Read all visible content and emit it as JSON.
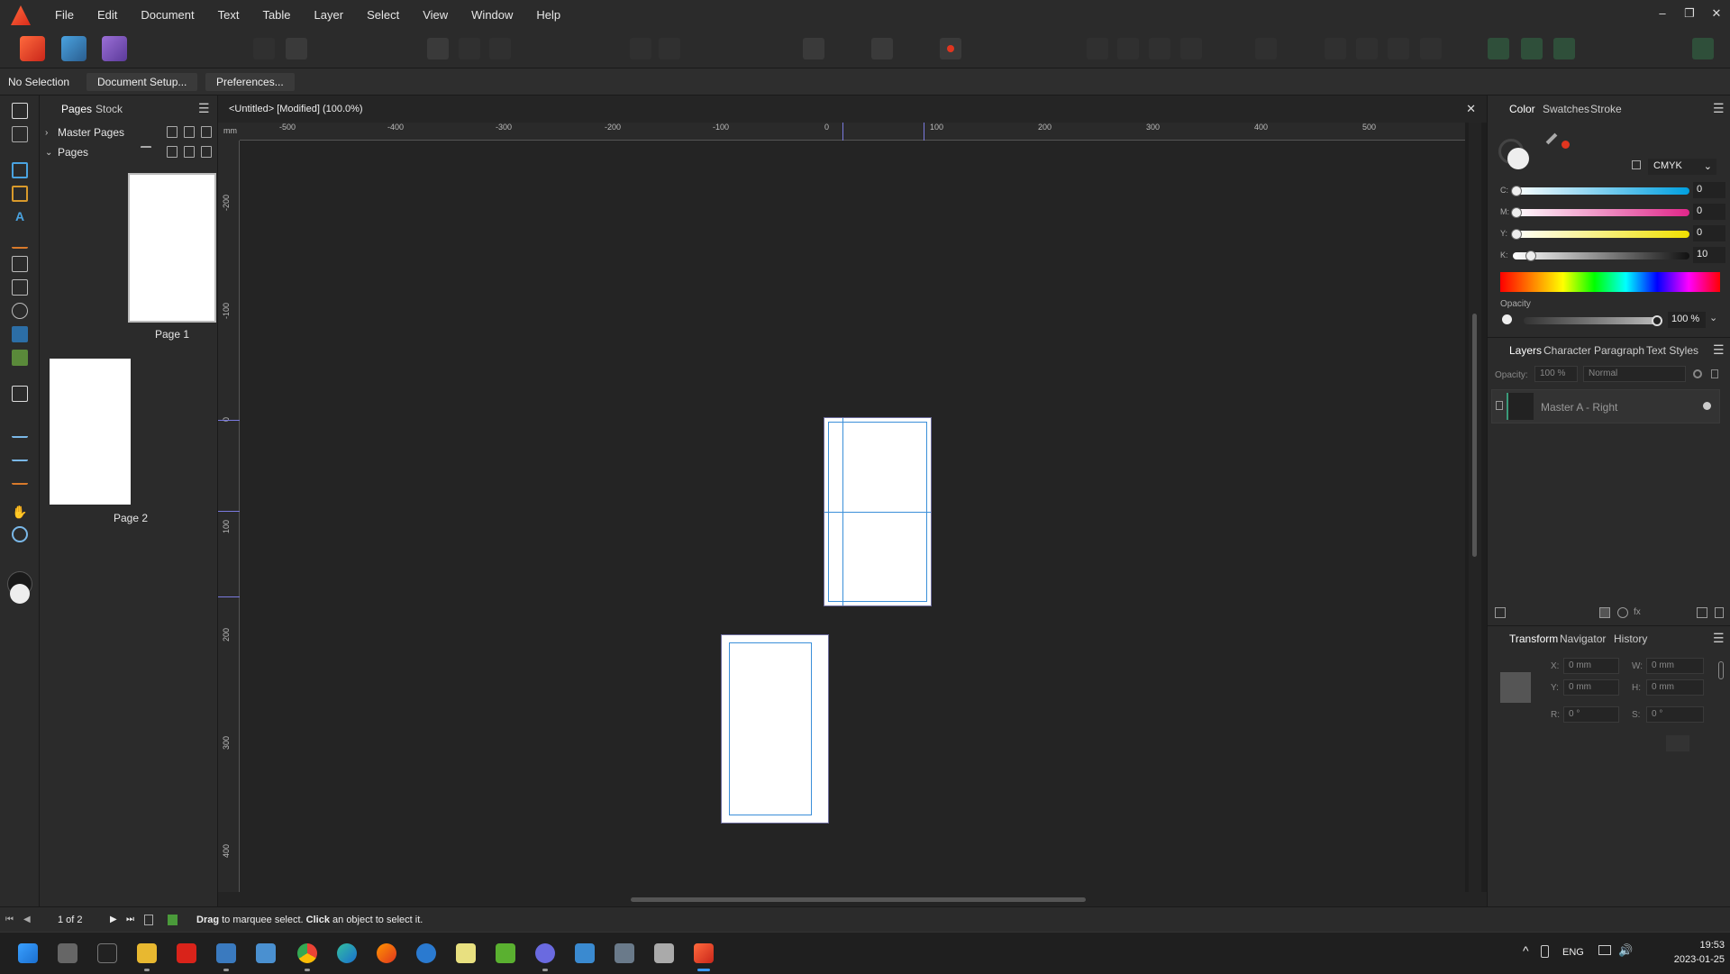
{
  "menubar": {
    "items": [
      "File",
      "Edit",
      "Document",
      "Text",
      "Table",
      "Layer",
      "Select",
      "View",
      "Window",
      "Help"
    ],
    "window_controls": [
      "–",
      "❐",
      "✕"
    ]
  },
  "context": {
    "selection": "No Selection",
    "document_setup": "Document Setup...",
    "preferences": "Preferences..."
  },
  "pages_panel": {
    "tabs": [
      "Pages",
      "Stock"
    ],
    "master_pages": "Master Pages",
    "pages": "Pages",
    "page1": "Page 1",
    "page2": "Page 2"
  },
  "document": {
    "title": "<Untitled> [Modified] (100.0%)",
    "close": "✕",
    "ruler_unit": "mm",
    "h_ticks": [
      "-500",
      "-400",
      "-300",
      "-200",
      "-100",
      "0",
      "100",
      "200",
      "300",
      "400",
      "500"
    ],
    "v_ticks": [
      "-200",
      "-100",
      "0",
      "100",
      "200",
      "300",
      "400"
    ]
  },
  "color_panel": {
    "tabs": [
      "Color",
      "Swatches",
      "Stroke"
    ],
    "model": "CMYK",
    "channels": [
      {
        "label": "C:",
        "value": "0",
        "level": 0
      },
      {
        "label": "M:",
        "value": "0",
        "level": 0
      },
      {
        "label": "Y:",
        "value": "0",
        "level": 0
      },
      {
        "label": "K:",
        "value": "10",
        "level": 0.1
      }
    ],
    "opacity_label": "Opacity",
    "opacity_value": "100 %"
  },
  "layers_panel": {
    "tabs": [
      "Layers",
      "Character",
      "Paragraph",
      "Text Styles"
    ],
    "opacity_label": "Opacity:",
    "opacity_value": "100 %",
    "blend_mode": "Normal",
    "layer_name": "Master A - Right"
  },
  "transform_panel": {
    "tabs": [
      "Transform",
      "Navigator",
      "History"
    ],
    "x_label": "X:",
    "x_value": "0 mm",
    "y_label": "Y:",
    "y_value": "0 mm",
    "w_label": "W:",
    "w_value": "0 mm",
    "h_label": "H:",
    "h_value": "0 mm",
    "r_label": "R:",
    "r_value": "0 °",
    "s_label": "S:",
    "s_value": "0 °"
  },
  "status": {
    "page_count": "1 of 2",
    "hint_drag": "Drag",
    "hint_mid": " to marquee select. ",
    "hint_click": "Click",
    "hint_end": " an object to select it."
  },
  "taskbar": {
    "language": "ENG",
    "time": "19:53",
    "date": "2023-01-25"
  },
  "colors": {
    "accent_blue": "#3b8fd9",
    "brand_red": "#e0351f"
  }
}
